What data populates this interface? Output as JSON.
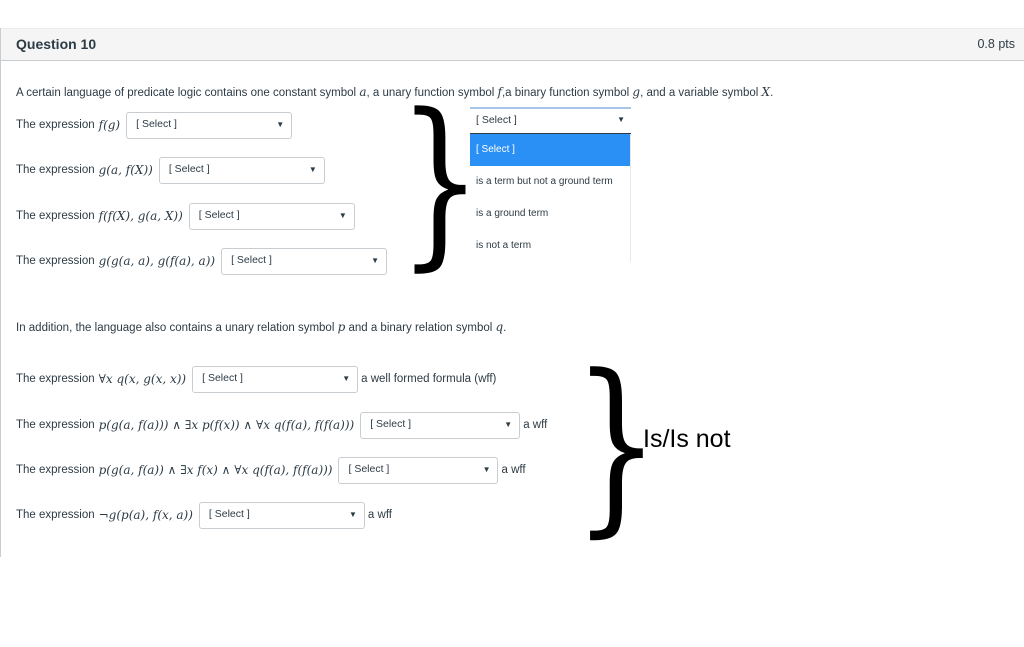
{
  "question": {
    "title": "Question 10",
    "points": "0.8 pts"
  },
  "intro": {
    "text_1": "A certain language of predicate logic contains one constant symbol ",
    "sym_a": "a",
    "text_2": ", a unary function symbol ",
    "sym_f": "f",
    "text_3": ",a binary function symbol ",
    "sym_g": "g",
    "text_4": ", and a variable symbol ",
    "sym_X": "X",
    "text_5": "."
  },
  "term_questions": [
    {
      "label": "The expression",
      "expression": "f(g)",
      "selected": "[ Select ]"
    },
    {
      "label": "The expression",
      "expression": "g(a, f(X))",
      "selected": "[ Select ]"
    },
    {
      "label": "The expression",
      "expression": "f(f(X), g(a, X))",
      "selected": "[ Select ]"
    },
    {
      "label": "The expression",
      "expression": "g(g(a, a), g(f(a), a))",
      "selected": "[ Select ]"
    }
  ],
  "term_dropdown": {
    "current": "[ Select ]",
    "options": [
      "[ Select ]",
      "is a term but not a ground term",
      "is a ground term",
      "is not a term"
    ],
    "highlighted_index": 0
  },
  "addition": {
    "text_1": "In addition, the language also contains a unary relation symbol ",
    "sym_p": "p",
    "text_2": " and a binary relation symbol ",
    "sym_q": "q",
    "text_3": "."
  },
  "wff_questions": [
    {
      "label": "The expression",
      "expression": "∀x q(x, g(x, x))",
      "selected": "[ Select ]",
      "suffix": "a well formed formula (wff)"
    },
    {
      "label": "The expression",
      "expression": "p(g(a, f(a))) ∧ ∃x p(f(x)) ∧ ∀x q(f(a), f(f(a)))",
      "selected": "[ Select ]",
      "suffix": "a wff"
    },
    {
      "label": "The expression",
      "expression": "p(g(a, f(a)) ∧ ∃x f(x) ∧ ∀x q(f(a), f(f(a)))",
      "selected": "[ Select ]",
      "suffix": "a wff"
    },
    {
      "label": "The expression",
      "expression": "¬g(p(a), f(x, a))",
      "selected": "[ Select ]",
      "suffix": "a wff"
    }
  ],
  "annotation": {
    "wff_options_note": "Is/Is not",
    "brace_glyph": "}"
  },
  "icons": {
    "dropdown_arrow": "▼"
  },
  "colors": {
    "highlight": "#2b90f5",
    "header_bg": "#f5f5f5",
    "text": "#2d3b45"
  }
}
